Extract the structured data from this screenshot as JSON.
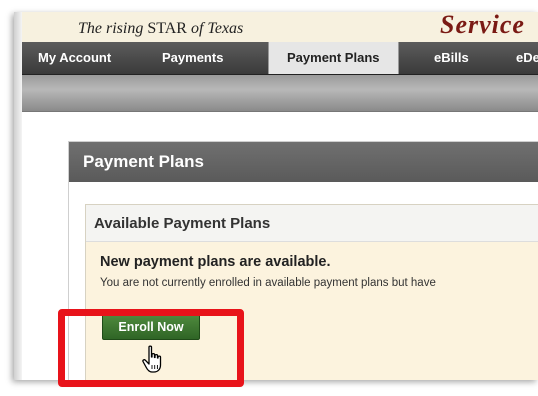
{
  "header": {
    "tagline_prefix": "The rising ",
    "tagline_star": "STAR",
    "tagline_suffix": " of Texas",
    "brand_partial": "Service"
  },
  "nav": {
    "tabs": [
      {
        "label": "My Account",
        "active": false
      },
      {
        "label": "Payments",
        "active": false
      },
      {
        "label": "Payment Plans",
        "active": true
      },
      {
        "label": "eBills",
        "active": false
      },
      {
        "label": "eDe",
        "active": false
      }
    ]
  },
  "panel": {
    "title": "Payment Plans",
    "card": {
      "title": "Available Payment Plans",
      "notice_heading": "New payment plans are available.",
      "notice_text": "You are not currently enrolled in available payment plans but have",
      "button_label": "Enroll Now"
    }
  },
  "colors": {
    "nav_bg": "#4a4a4a",
    "panel_header_bg": "#666666",
    "card_body_bg": "#fcf3de",
    "button_bg": "#3c7330",
    "highlight": "#e8131a",
    "brand": "#7a1a14"
  },
  "icons": {
    "cursor": "hand-pointer-icon"
  }
}
